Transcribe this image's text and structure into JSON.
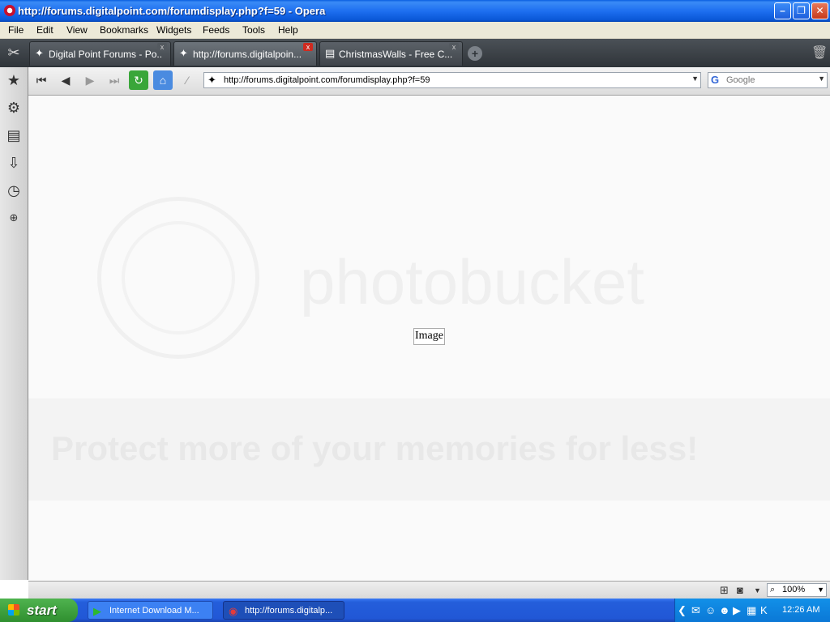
{
  "window": {
    "title": "http://forums.digitalpoint.com/forumdisplay.php?f=59 - Opera",
    "min_glyph": "–",
    "max_glyph": "❐",
    "close_glyph": "✕"
  },
  "menu": [
    "File",
    "Edit",
    "View",
    "Bookmarks",
    "Widgets",
    "Feeds",
    "Tools",
    "Help"
  ],
  "tabs": [
    {
      "label": "Digital Point Forums - Po...",
      "icon": "digitalpoint-icon",
      "glyph": "✦"
    },
    {
      "label": "http://forums.digitalpoin...",
      "icon": "digitalpoint-icon",
      "glyph": "✦"
    },
    {
      "label": "ChristmasWalls - Free C...",
      "icon": "page-icon",
      "glyph": "▤"
    }
  ],
  "tab_close_glyph": "x",
  "new_tab_glyph": "+",
  "address": {
    "url": "http://forums.digitalpoint.com/forumdisplay.php?f=59",
    "site_glyph": "✦"
  },
  "search": {
    "placeholder": "Google",
    "engine_glyph": "G"
  },
  "content": {
    "broken_image_alt": "Image",
    "watermark_text": "photobucket",
    "watermark_banner": "Protect more of your memories for less!"
  },
  "statusbar": {
    "zoom": "100%"
  },
  "taskbar": {
    "start_label": "start",
    "tasks": [
      {
        "label": "Internet Download M...",
        "icon": "idm-icon",
        "glyph": "▶"
      },
      {
        "label": "http://forums.digitalp...",
        "icon": "opera-icon",
        "glyph": "◉"
      }
    ],
    "clock": "12:26 AM"
  },
  "colors": {
    "title_bar": "#1e6ff0",
    "tab_bar": "#3a3f45",
    "taskbar": "#2157d6",
    "start_button": "#3da33d",
    "tray": "#0b78d6"
  }
}
